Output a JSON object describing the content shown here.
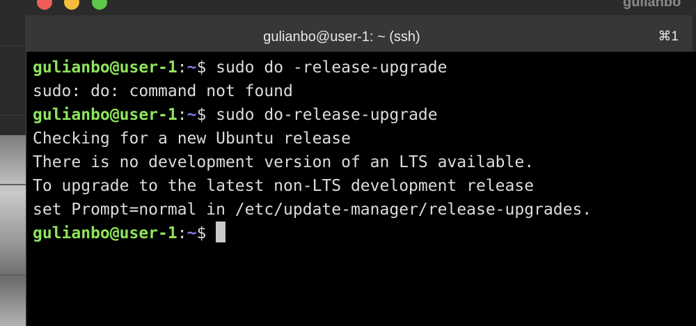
{
  "background_window": {
    "title_fragment": "gulianbo"
  },
  "terminal": {
    "title": "gulianbo@user-1: ~ (ssh)",
    "shortcut": "⌘1",
    "prompt": {
      "user_host": "gulianbo@user-1",
      "colon": ":",
      "path": "~",
      "dollar": "$ "
    },
    "lines": [
      {
        "type": "prompt",
        "command": "sudo do -release-upgrade"
      },
      {
        "type": "output",
        "text": "sudo: do: command not found"
      },
      {
        "type": "prompt",
        "command": "sudo do-release-upgrade"
      },
      {
        "type": "output",
        "text": "Checking for a new Ubuntu release"
      },
      {
        "type": "output",
        "text": "There is no development version of an LTS available."
      },
      {
        "type": "output",
        "text": "To upgrade to the latest non-LTS development release"
      },
      {
        "type": "output",
        "text": "set Prompt=normal in /etc/update-manager/release-upgrades."
      },
      {
        "type": "prompt",
        "command": ""
      }
    ],
    "colors": {
      "user_host": "#8ee55b",
      "path": "#7f7ff0",
      "text": "#dcdcdc",
      "background": "#000000"
    }
  }
}
